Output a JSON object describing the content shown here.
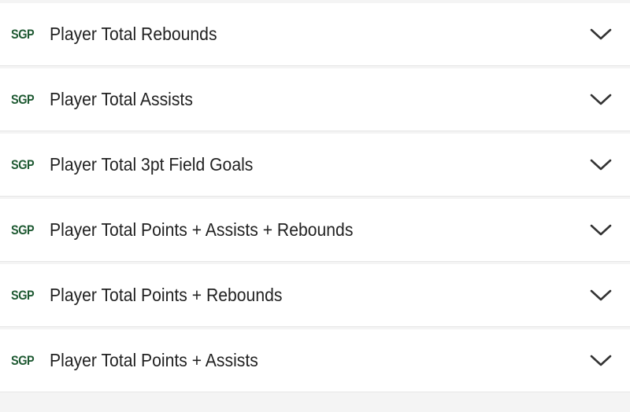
{
  "colors": {
    "badge": "#1f5a33",
    "text": "#222222",
    "chevron": "#333333",
    "divider": "#e6e6e6",
    "background": "#ffffff"
  },
  "markets": [
    {
      "badge": "SGP",
      "label": "Player Total Rebounds",
      "icon": "chevron-down-icon"
    },
    {
      "badge": "SGP",
      "label": "Player Total Assists",
      "icon": "chevron-down-icon"
    },
    {
      "badge": "SGP",
      "label": "Player Total 3pt Field Goals",
      "icon": "chevron-down-icon"
    },
    {
      "badge": "SGP",
      "label": "Player Total Points + Assists + Rebounds",
      "icon": "chevron-down-icon"
    },
    {
      "badge": "SGP",
      "label": "Player Total Points + Rebounds",
      "icon": "chevron-down-icon"
    },
    {
      "badge": "SGP",
      "label": "Player Total Points + Assists",
      "icon": "chevron-down-icon"
    }
  ]
}
